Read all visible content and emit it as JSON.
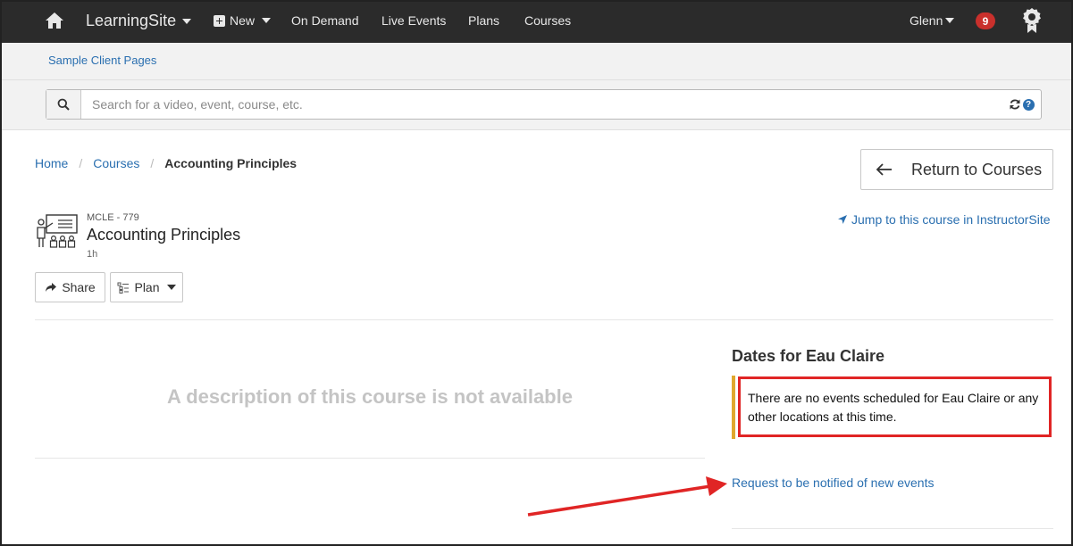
{
  "topnav": {
    "brand": "LearningSite",
    "new_label": "New",
    "links": [
      "On Demand",
      "Live Events",
      "Plans",
      "Courses"
    ],
    "user_name": "Glenn",
    "notification_count": "9"
  },
  "subbar": {
    "link_label": "Sample Client Pages"
  },
  "search": {
    "placeholder": "Search for a video, event, course, etc.",
    "value": ""
  },
  "breadcrumb": {
    "items": [
      "Home",
      "Courses"
    ],
    "current": "Accounting Principles"
  },
  "return_button": {
    "label": "Return to Courses"
  },
  "course": {
    "code": "MCLE - 779",
    "title": "Accounting Principles",
    "duration": "1h",
    "jump_link": "Jump to this course in InstructorSite",
    "description_empty": "A description of this course is not available"
  },
  "actions": {
    "share_label": "Share",
    "plan_label": "Plan"
  },
  "dates": {
    "title": "Dates for Eau Claire",
    "alert_text": "There are no events scheduled for Eau Claire or any other locations at this time.",
    "notify_link": "Request to be notified of new events"
  },
  "colors": {
    "nav_bg": "#2b2b2b",
    "link": "#2a6fb0",
    "badge": "#c9302c",
    "annotation": "#e02525",
    "alert_accent": "#e0a82e"
  }
}
